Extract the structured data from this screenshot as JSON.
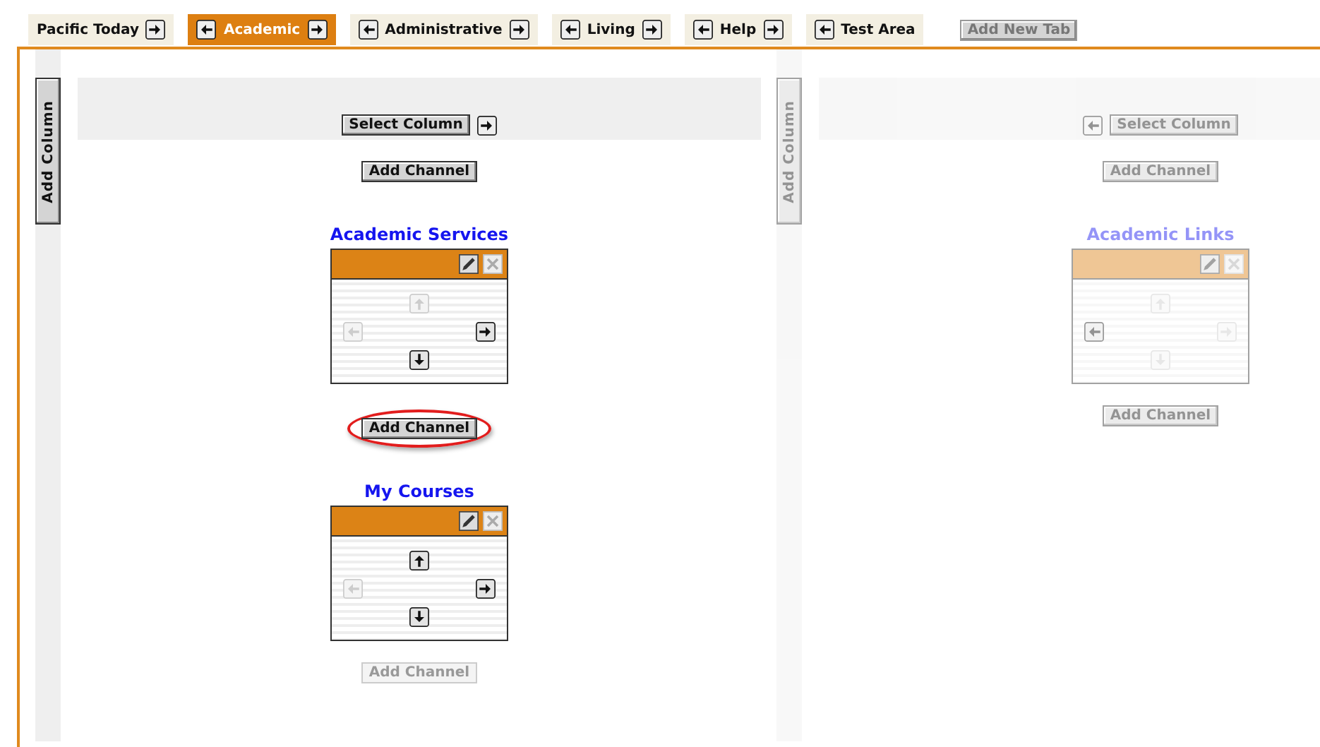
{
  "tabs": [
    {
      "label": "Pacific Today",
      "selected": false,
      "left_arrow": false,
      "right_arrow": true
    },
    {
      "label": "Academic",
      "selected": true,
      "left_arrow": true,
      "right_arrow": true
    },
    {
      "label": "Administrative",
      "selected": false,
      "left_arrow": true,
      "right_arrow": true
    },
    {
      "label": "Living",
      "selected": false,
      "left_arrow": true,
      "right_arrow": true
    },
    {
      "label": "Help",
      "selected": false,
      "left_arrow": true,
      "right_arrow": true
    },
    {
      "label": "Test Area",
      "selected": false,
      "left_arrow": true,
      "right_arrow": false
    }
  ],
  "add_tab_button": "Add New Tab",
  "columns": [
    {
      "add_column": "Add Column",
      "select_column": "Select Column",
      "select_left_arrow": false,
      "select_right_arrow": true,
      "dimmed": false,
      "items": [
        {
          "kind": "button",
          "label": "Add Channel",
          "dimmed": false,
          "highlighted": false
        },
        {
          "kind": "channel",
          "title": "Academic Services",
          "dimmed": false,
          "moves": {
            "up": false,
            "left": false,
            "right": true,
            "down": true
          }
        },
        {
          "kind": "button",
          "label": "Add Channel",
          "dimmed": false,
          "highlighted": true
        },
        {
          "kind": "channel",
          "title": "My Courses",
          "dimmed": false,
          "moves": {
            "up": true,
            "left": false,
            "right": true,
            "down": true
          }
        },
        {
          "kind": "button",
          "label": "Add Channel",
          "dimmed": true,
          "highlighted": false
        }
      ]
    },
    {
      "add_column": "Add Column",
      "select_column": "Select Column",
      "select_left_arrow": true,
      "select_right_arrow": false,
      "dimmed": true,
      "items": [
        {
          "kind": "button",
          "label": "Add Channel",
          "dimmed": false,
          "highlighted": false
        },
        {
          "kind": "channel",
          "title": "Academic Links",
          "dimmed": false,
          "moves": {
            "up": false,
            "left": true,
            "right": false,
            "down": false
          }
        },
        {
          "kind": "button",
          "label": "Add Channel",
          "dimmed": false,
          "highlighted": false
        }
      ]
    }
  ]
}
